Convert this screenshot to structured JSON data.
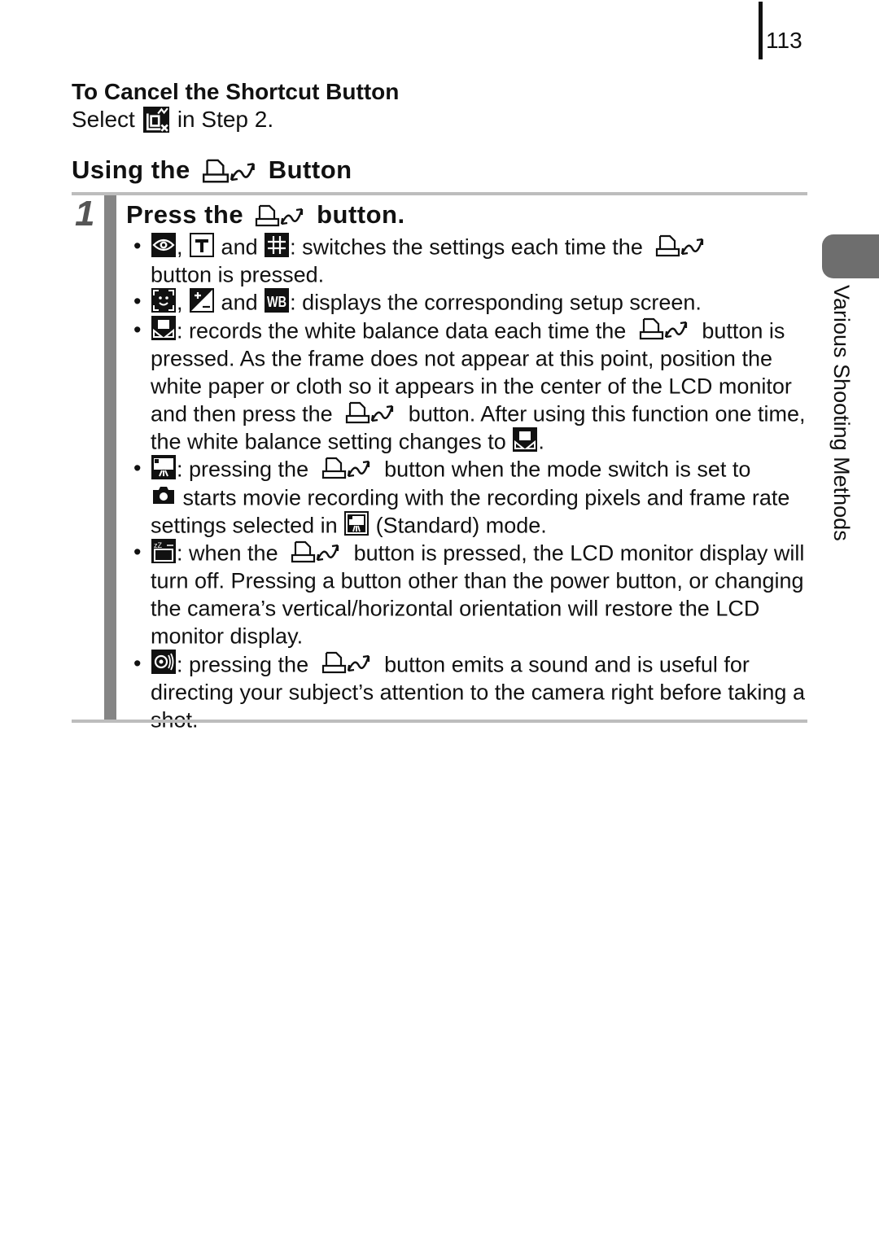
{
  "page_number": "113",
  "cancel": {
    "title": "To Cancel the Shortcut Button",
    "select": "Select",
    "rest": "in Step 2."
  },
  "section": {
    "title_before": "Using the",
    "title_after": "Button"
  },
  "step": {
    "number": "1",
    "title_before": "Press the",
    "title_after": "button."
  },
  "bullets": [
    {
      "a": ",",
      "b": "and",
      "c": ": switches the settings each time the",
      "d": "button is pressed."
    },
    {
      "a": ",",
      "b": "and",
      "c": ": displays the corresponding setup screen."
    },
    {
      "a": ": records the white balance data each time the",
      "b": "button is pressed. As the frame does not appear at this point, position the white paper or cloth so it appears in the center of the LCD monitor and then press the",
      "c": "button. After using this function one time, the white balance setting changes to",
      "d": "."
    },
    {
      "a": ": pressing the",
      "b": "button when the mode switch is set to",
      "c": "starts movie recording with the recording pixels and frame rate settings selected in",
      "d": "(Standard) mode."
    },
    {
      "a": ": when the",
      "b": "button is pressed, the LCD monitor display will turn off. Pressing a button other than the power button, or changing the camera’s vertical/horizontal orientation will restore the LCD monitor display."
    },
    {
      "a": ": pressing the",
      "b": "button emits a sound and is useful for directing your subject’s attention to the camera right before taking a shot."
    }
  ],
  "side_tab": {
    "label": "Various Shooting Methods",
    "color": "#6e6e6e"
  },
  "colors": {
    "rule": "#bdbdbd",
    "step_bar": "#858585",
    "step_number": "#555555"
  }
}
